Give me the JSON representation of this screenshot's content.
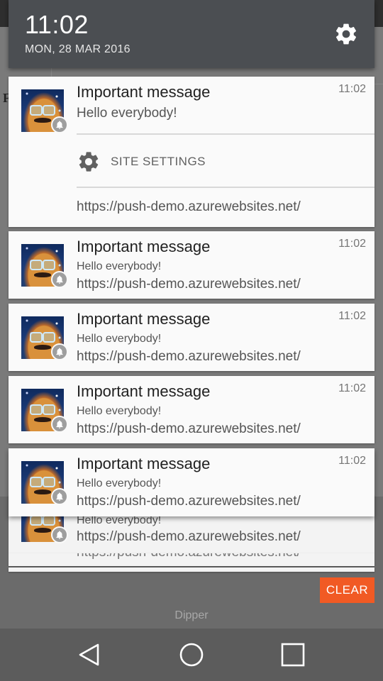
{
  "status": {
    "time": "11:02",
    "date": "MON, 28 MAR 2016"
  },
  "background_page": {
    "char": "F"
  },
  "expanded_notification": {
    "title": "Important message",
    "time": "11:02",
    "body": "Hello everybody!",
    "site_settings_label": "SITE SETTINGS",
    "url": "https://push-demo.azurewebsites.net/"
  },
  "notifications": [
    {
      "title": "Important message",
      "time": "11:02",
      "body": "Hello everybody!",
      "url": "https://push-demo.azurewebsites.net/"
    },
    {
      "title": "Important message",
      "time": "11:02",
      "body": "Hello everybody!",
      "url": "https://push-demo.azurewebsites.net/"
    },
    {
      "title": "Important message",
      "time": "11:02",
      "body": "Hello everybody!",
      "url": "https://push-demo.azurewebsites.net/"
    },
    {
      "title": "Important message",
      "time": "11:02",
      "body": "Hello everybody!",
      "url": "https://push-demo.azurewebsites.net/"
    }
  ],
  "stacked_notifications": [
    {
      "body": "Hello everybody!",
      "url": "https://push-demo.azurewebsites.net/"
    },
    {
      "url": "https://push-demo.azurewebsites.net/"
    }
  ],
  "clear_label": "CLEAR",
  "carrier": "Dipper",
  "icons": {
    "settings": "gear-icon",
    "notification_badge": "bell-icon",
    "site_settings": "gear-icon",
    "back": "back-triangle-icon",
    "home": "home-circle-icon",
    "recents": "recents-square-icon"
  },
  "colors": {
    "header_bg": "#4b4e52",
    "card_bg": "#fafafa",
    "clear_button": "#f15a24",
    "navbar_bg": "#5c5c5c"
  }
}
